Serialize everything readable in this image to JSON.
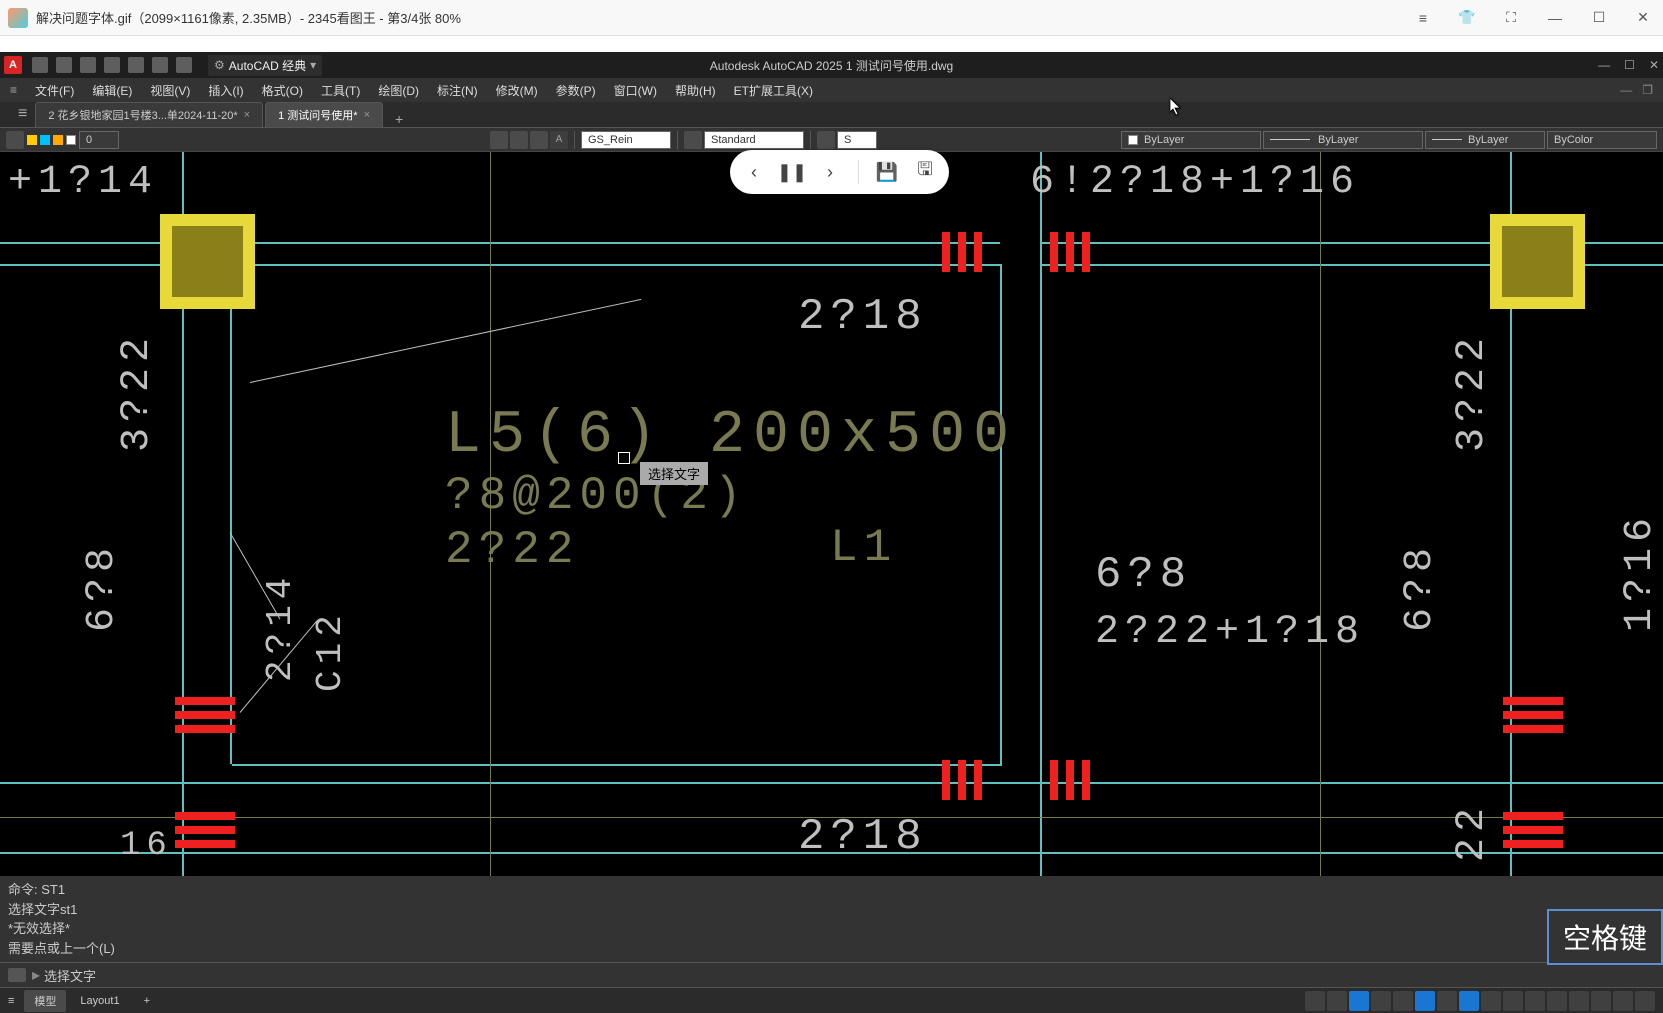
{
  "viewer": {
    "title": "解决问题字体.gif（2099×1161像素, 2.35MB）- 2345看图王 - 第3/4张 80%"
  },
  "acad": {
    "workspace_label": "AutoCAD 经典",
    "title": "Autodesk AutoCAD 2025    1  测试问号使用.dwg",
    "menus": [
      "文件(F)",
      "编辑(E)",
      "视图(V)",
      "插入(I)",
      "格式(O)",
      "工具(T)",
      "绘图(D)",
      "标注(N)",
      "修改(M)",
      "参数(P)",
      "窗口(W)",
      "帮助(H)",
      "ET扩展工具(X)"
    ],
    "tabs": {
      "inactive": "2 花乡银地家园1号楼3...单2024-11-20*",
      "active": "1  测试问号使用*"
    },
    "toolbar": {
      "layer_0": "0",
      "style1": "GS_Rein",
      "style2": "Standard",
      "style3": "S",
      "bylayer1": "ByLayer",
      "bylayer2": "ByLayer",
      "bylayer3": "ByLayer",
      "bycolor": "ByColor"
    },
    "drawing_texts": {
      "top_left": "+1?14",
      "top_right": "6!2?18+1?16",
      "side_left_upper": "3?22",
      "side_right_upper": "3?22",
      "label_2_18_top": "2?18",
      "main_label": "L5(6) 200x500",
      "sub_label1": "?8@200(2)",
      "sub_label2": "2?22",
      "l1": "L1",
      "side_6_8_left": "6?8",
      "side_6_8_right": "6?8",
      "side_2_14": "2?14",
      "side_c12": "C12",
      "label_6_8_mid": "6?8",
      "label_2_22_right": "2?22+1?18",
      "label_2_18_bottom": "2?18",
      "bottom_left_16": "16",
      "side_22_right": "22",
      "side_1_16_right": "1?16",
      "tooltip": "选择文字"
    },
    "cmd": {
      "l1": "命令: ST1",
      "l2": "选择文字st1",
      "l3": "*无效选择*",
      "l4": "需要点或上一个(L)",
      "prompt": "选择文字"
    },
    "status": {
      "model": "模型",
      "layout": "Layout1"
    },
    "hint": "空格键"
  }
}
